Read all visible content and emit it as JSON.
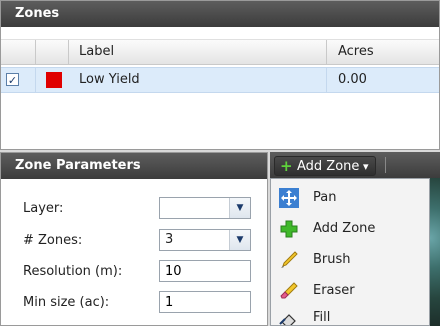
{
  "zones_panel": {
    "title": "Zones",
    "columns": {
      "label": "Label",
      "acres": "Acres"
    },
    "rows": [
      {
        "checked": "✓",
        "label": "Low Yield",
        "acres": "0.00",
        "color": "#e00000"
      }
    ]
  },
  "params_panel": {
    "title": "Zone Parameters",
    "layer_label": "Layer:",
    "layer_value": "",
    "zones_label": "# Zones:",
    "zones_value": "3",
    "resolution_label": "Resolution (m):",
    "resolution_value": "10",
    "min_size_label": "Min size (ac):",
    "min_size_value": "1"
  },
  "toolbar": {
    "add_zone_label": "Add Zone",
    "dropdown_arrow": "▾"
  },
  "tool_menu": {
    "items": [
      {
        "label": "Pan",
        "icon": "pan-icon"
      },
      {
        "label": "Add Zone",
        "icon": "add-icon"
      },
      {
        "label": "Brush",
        "icon": "brush-icon"
      },
      {
        "label": "Eraser",
        "icon": "eraser-icon"
      },
      {
        "label": "Fill",
        "icon": "fill-icon"
      }
    ]
  }
}
